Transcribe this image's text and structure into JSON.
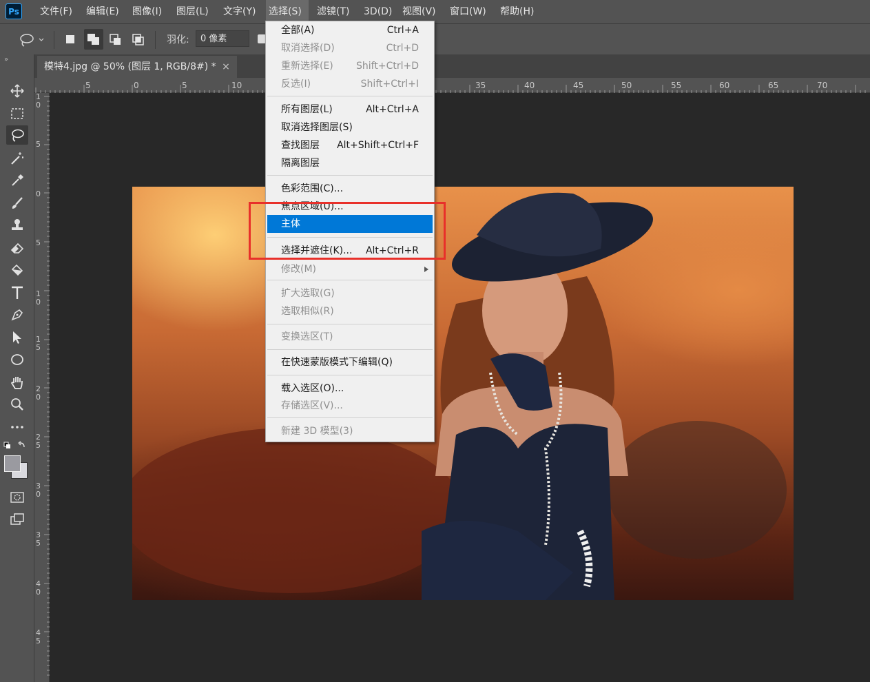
{
  "app": {
    "logo": "Ps"
  },
  "menubar": {
    "items": [
      "文件(F)",
      "编辑(E)",
      "图像(I)",
      "图层(L)",
      "文字(Y)",
      "选择(S)",
      "滤镜(T)",
      "3D(D)",
      "视图(V)",
      "窗口(W)",
      "帮助(H)"
    ],
    "active_index": 5
  },
  "options_bar": {
    "tool_icon": "lasso-icon",
    "selection_modes": [
      "new-selection-icon",
      "add-selection-icon",
      "subtract-selection-icon",
      "intersect-selection-icon"
    ],
    "feather_label": "羽化:",
    "feather_value": "0 像素"
  },
  "toolbar": {
    "tools": [
      "move-icon",
      "marquee-icon",
      "lasso-icon",
      "magic-wand-icon",
      "eyedropper-icon",
      "brush-icon",
      "stamp-icon",
      "eraser-icon",
      "paint-bucket-icon",
      "type-icon",
      "pen-icon",
      "path-select-icon",
      "ellipse-icon",
      "hand-icon",
      "zoom-icon",
      "more-tools-icon",
      "swap-colors-icon",
      "color-swatch-icon",
      "quick-mask-icon",
      "screen-mode-icon"
    ],
    "selected_tool": "lasso-icon"
  },
  "document": {
    "tab_title": "模特4.jpg @ 50% (图层 1, RGB/8#) *",
    "close_glyph": "×"
  },
  "ruler_top": {
    "labels": [
      "5",
      "0",
      "5",
      "10",
      "35",
      "40",
      "45",
      "50",
      "55",
      "60",
      "65",
      "70"
    ]
  },
  "ruler_left": {
    "labels": [
      "1\n0",
      "5",
      "0",
      "5",
      "1\n0",
      "1\n5",
      "2\n0",
      "2\n5",
      "3\n0",
      "3\n5",
      "4\n0",
      "4\n5"
    ]
  },
  "select_menu": {
    "items": [
      {
        "label": "全部(A)",
        "shortcut": "Ctrl+A",
        "disabled": false
      },
      {
        "label": "取消选择(D)",
        "shortcut": "Ctrl+D",
        "disabled": true
      },
      {
        "label": "重新选择(E)",
        "shortcut": "Shift+Ctrl+D",
        "disabled": true
      },
      {
        "label": "反选(I)",
        "shortcut": "Shift+Ctrl+I",
        "disabled": true
      },
      {
        "label": "所有图层(L)",
        "shortcut": "Alt+Ctrl+A",
        "disabled": false
      },
      {
        "label": "取消选择图层(S)",
        "shortcut": "",
        "disabled": false
      },
      {
        "label": "查找图层",
        "shortcut": "Alt+Shift+Ctrl+F",
        "disabled": false
      },
      {
        "label": "隔离图层",
        "shortcut": "",
        "disabled": false
      },
      {
        "label": "色彩范围(C)...",
        "shortcut": "",
        "disabled": false
      },
      {
        "label": "焦点区域(U)...",
        "shortcut": "",
        "disabled": false
      },
      {
        "label": "主体",
        "shortcut": "",
        "disabled": false,
        "highlighted": true
      },
      {
        "label": "选择并遮住(K)...",
        "shortcut": "Alt+Ctrl+R",
        "disabled": false
      },
      {
        "label": "修改(M)",
        "shortcut": "",
        "disabled": true,
        "submenu": true
      },
      {
        "label": "扩大选取(G)",
        "shortcut": "",
        "disabled": true
      },
      {
        "label": "选取相似(R)",
        "shortcut": "",
        "disabled": true
      },
      {
        "label": "变换选区(T)",
        "shortcut": "",
        "disabled": true
      },
      {
        "label": "在快速蒙版模式下编辑(Q)",
        "shortcut": "",
        "disabled": false
      },
      {
        "label": "载入选区(O)...",
        "shortcut": "",
        "disabled": false
      },
      {
        "label": "存储选区(V)...",
        "shortcut": "",
        "disabled": true
      },
      {
        "label": "新建 3D 模型(3)",
        "shortcut": "",
        "disabled": true
      }
    ]
  },
  "colors": {
    "highlight": "#0078d7",
    "annotation_box": "#e8302a"
  }
}
